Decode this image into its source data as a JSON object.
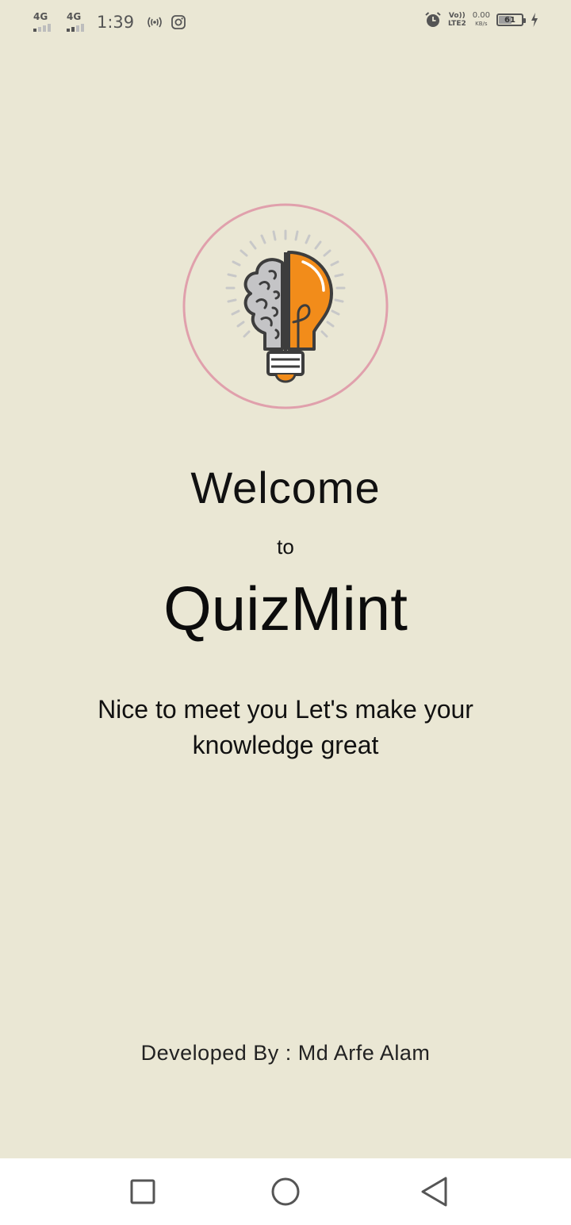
{
  "status_bar": {
    "sim1_network": "4G",
    "sim2_network": "4G",
    "time": "1:39",
    "volte_line1": "Vo))",
    "volte_line2": "LTE2",
    "net_speed_value": "0.00",
    "net_speed_unit": "KB/s",
    "battery_level": "61",
    "icons": [
      "signal-icon",
      "signal-icon",
      "hotspot-icon",
      "instagram-icon",
      "alarm-icon",
      "volte-icon",
      "battery-icon",
      "charging-icon"
    ]
  },
  "colors": {
    "background": "#eae7d4",
    "logo_ring": "#e0a0ac",
    "bulb_orange": "#f28c1a",
    "brain_gray": "#c4c4c6",
    "outline": "#3d3d3d",
    "nav_bar": "#ffffff"
  },
  "welcome": {
    "title": "Welcome",
    "connector": "to",
    "app_name": "QuizMint",
    "tagline": "Nice to meet you Let's make your knowledge great"
  },
  "footer": {
    "developer_credit": "Developed By : Md Arfe Alam"
  },
  "nav_bar": {
    "buttons": [
      "recents-button",
      "home-button",
      "back-button"
    ]
  }
}
